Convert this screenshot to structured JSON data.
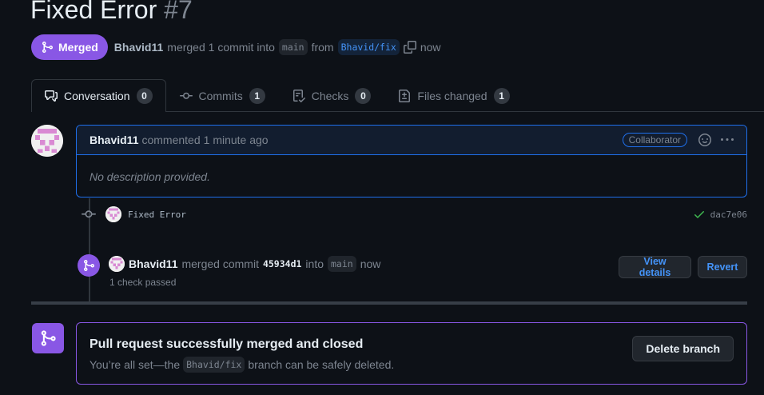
{
  "pr": {
    "title": "Fixed Error",
    "number": "#7",
    "state": "Merged",
    "author": "Bhavid11",
    "merged_text": "merged 1 commit into",
    "base_branch": "main",
    "from_text": "from",
    "head_branch": "Bhavid/fix",
    "time": "now"
  },
  "tabs": [
    {
      "label": "Conversation",
      "count": "0",
      "icon": "comment-discussion-icon"
    },
    {
      "label": "Commits",
      "count": "1",
      "icon": "git-commit-icon"
    },
    {
      "label": "Checks",
      "count": "0",
      "icon": "checklist-icon"
    },
    {
      "label": "Files changed",
      "count": "1",
      "icon": "file-diff-icon"
    }
  ],
  "comment": {
    "author": "Bhavid11",
    "action": "commented",
    "time": "1 minute ago",
    "role": "Collaborator",
    "body": "No description provided."
  },
  "commit": {
    "message": "Fixed Error",
    "sha": "dac7e06",
    "status": "success"
  },
  "merge_event": {
    "author": "Bhavid11",
    "action": "merged commit",
    "sha": "45934d1",
    "into_text": "into",
    "branch": "main",
    "time": "now",
    "checks": "1 check passed",
    "view_details_label": "View details",
    "revert_label": "Revert"
  },
  "merge_box": {
    "heading": "Pull request successfully merged and closed",
    "sub_prefix": "You’re all set—the",
    "branch": "Bhavid/fix",
    "sub_suffix": "branch can be safely deleted.",
    "delete_label": "Delete branch"
  },
  "colors": {
    "merged": "#8957e5",
    "accent": "#4493f8",
    "success": "#3fb950",
    "background": "#0d1117"
  }
}
